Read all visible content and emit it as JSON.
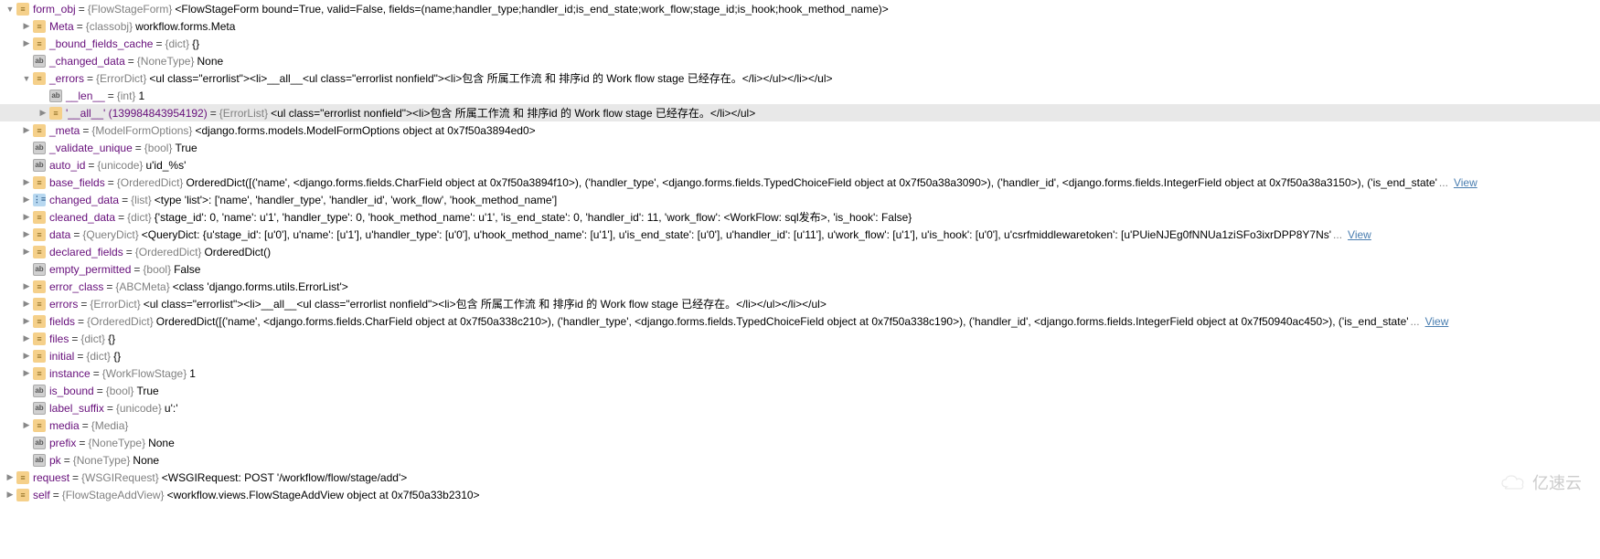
{
  "watermark": "亿速云",
  "icons": {
    "obj": "≡",
    "str": "ab",
    "list": "⋮≡"
  },
  "rows": [
    {
      "indent": 0,
      "arrow": "down",
      "icon": "obj",
      "name": "form_obj",
      "type": "{FlowStageForm}",
      "val": "<FlowStageForm bound=True, valid=False, fields=(name;handler_type;handler_id;is_end_state;work_flow;stage_id;is_hook;hook_method_name)>"
    },
    {
      "indent": 1,
      "arrow": "right",
      "icon": "obj",
      "name": "Meta",
      "type": "{classobj}",
      "val": "workflow.forms.Meta"
    },
    {
      "indent": 1,
      "arrow": "right",
      "icon": "obj",
      "name": "_bound_fields_cache",
      "type": "{dict}",
      "val": "{}"
    },
    {
      "indent": 1,
      "arrow": "blank",
      "icon": "str",
      "name": "_changed_data",
      "type": "{NoneType}",
      "val": "None"
    },
    {
      "indent": 1,
      "arrow": "down",
      "icon": "obj",
      "name": "_errors",
      "type": "{ErrorDict}",
      "val": "<ul class=\"errorlist\"><li>__all__<ul class=\"errorlist nonfield\"><li>包含 所属工作流 和 排序id 的 Work flow stage 已经存在。</li></ul></li></ul>"
    },
    {
      "indent": 2,
      "arrow": "blank",
      "icon": "str",
      "name": "__len__",
      "type": "{int}",
      "val": "1"
    },
    {
      "indent": 2,
      "arrow": "right",
      "icon": "obj",
      "name": "'__all__' (139984843954192)",
      "type": "{ErrorList}",
      "val": "<ul class=\"errorlist nonfield\"><li>包含 所属工作流 和 排序id 的 Work flow stage 已经存在。</li></ul>",
      "highlighted": true
    },
    {
      "indent": 1,
      "arrow": "right",
      "icon": "obj",
      "name": "_meta",
      "type": "{ModelFormOptions}",
      "val": "<django.forms.models.ModelFormOptions object at 0x7f50a3894ed0>"
    },
    {
      "indent": 1,
      "arrow": "blank",
      "icon": "str",
      "name": "_validate_unique",
      "type": "{bool}",
      "val": "True"
    },
    {
      "indent": 1,
      "arrow": "blank",
      "icon": "str",
      "name": "auto_id",
      "type": "{unicode}",
      "val": "u'id_%s'"
    },
    {
      "indent": 1,
      "arrow": "right",
      "icon": "obj",
      "name": "base_fields",
      "type": "{OrderedDict}",
      "val": "OrderedDict([('name', <django.forms.fields.CharField object at 0x7f50a3894f10>), ('handler_type', <django.forms.fields.TypedChoiceField object at 0x7f50a38a3090>), ('handler_id', <django.forms.fields.IntegerField object at 0x7f50a38a3150>), ('is_end_state'",
      "view": true
    },
    {
      "indent": 1,
      "arrow": "right",
      "icon": "list",
      "name": "changed_data",
      "type": "{list}",
      "val": "<type 'list'>: ['name', 'handler_type', 'handler_id', 'work_flow', 'hook_method_name']"
    },
    {
      "indent": 1,
      "arrow": "right",
      "icon": "obj",
      "name": "cleaned_data",
      "type": "{dict}",
      "val": "{'stage_id': 0, 'name': u'1', 'handler_type': 0, 'hook_method_name': u'1', 'is_end_state': 0, 'handler_id': 11, 'work_flow': <WorkFlow: sql发布>, 'is_hook': False}"
    },
    {
      "indent": 1,
      "arrow": "right",
      "icon": "obj",
      "name": "data",
      "type": "{QueryDict}",
      "val": "<QueryDict: {u'stage_id': [u'0'], u'name': [u'1'], u'handler_type': [u'0'], u'hook_method_name': [u'1'], u'is_end_state': [u'0'], u'handler_id': [u'11'], u'work_flow': [u'1'], u'is_hook': [u'0'], u'csrfmiddlewaretoken': [u'PUieNJEg0fNNUa1ziSFo3ixrDPP8Y7Ns'",
      "view": true
    },
    {
      "indent": 1,
      "arrow": "right",
      "icon": "obj",
      "name": "declared_fields",
      "type": "{OrderedDict}",
      "val": "OrderedDict()"
    },
    {
      "indent": 1,
      "arrow": "blank",
      "icon": "str",
      "name": "empty_permitted",
      "type": "{bool}",
      "val": "False"
    },
    {
      "indent": 1,
      "arrow": "right",
      "icon": "obj",
      "name": "error_class",
      "type": "{ABCMeta}",
      "val": "<class 'django.forms.utils.ErrorList'>"
    },
    {
      "indent": 1,
      "arrow": "right",
      "icon": "obj",
      "name": "errors",
      "type": "{ErrorDict}",
      "val": "<ul class=\"errorlist\"><li>__all__<ul class=\"errorlist nonfield\"><li>包含 所属工作流 和 排序id 的 Work flow stage 已经存在。</li></ul></li></ul>"
    },
    {
      "indent": 1,
      "arrow": "right",
      "icon": "obj",
      "name": "fields",
      "type": "{OrderedDict}",
      "val": "OrderedDict([('name', <django.forms.fields.CharField object at 0x7f50a338c210>), ('handler_type', <django.forms.fields.TypedChoiceField object at 0x7f50a338c190>), ('handler_id', <django.forms.fields.IntegerField object at 0x7f50940ac450>), ('is_end_state'",
      "view": true
    },
    {
      "indent": 1,
      "arrow": "right",
      "icon": "obj",
      "name": "files",
      "type": "{dict}",
      "val": "{}"
    },
    {
      "indent": 1,
      "arrow": "right",
      "icon": "obj",
      "name": "initial",
      "type": "{dict}",
      "val": "{}"
    },
    {
      "indent": 1,
      "arrow": "right",
      "icon": "obj",
      "name": "instance",
      "type": "{WorkFlowStage}",
      "val": "1"
    },
    {
      "indent": 1,
      "arrow": "blank",
      "icon": "str",
      "name": "is_bound",
      "type": "{bool}",
      "val": "True"
    },
    {
      "indent": 1,
      "arrow": "blank",
      "icon": "str",
      "name": "label_suffix",
      "type": "{unicode}",
      "val": "u':'"
    },
    {
      "indent": 1,
      "arrow": "right",
      "icon": "obj",
      "name": "media",
      "type": "{Media}",
      "val": ""
    },
    {
      "indent": 1,
      "arrow": "blank",
      "icon": "str",
      "name": "prefix",
      "type": "{NoneType}",
      "val": "None"
    },
    {
      "indent": 0,
      "arrow": "blank",
      "icon": "str",
      "name": "pk",
      "type": "{NoneType}",
      "val": "None",
      "extraIndent": true
    },
    {
      "indent": 0,
      "arrow": "right",
      "icon": "obj",
      "name": "request",
      "type": "{WSGIRequest}",
      "val": "<WSGIRequest: POST '/workflow/flow/stage/add'>"
    },
    {
      "indent": 0,
      "arrow": "right",
      "icon": "obj",
      "name": "self",
      "type": "{FlowStageAddView}",
      "val": "<workflow.views.FlowStageAddView object at 0x7f50a33b2310>"
    }
  ],
  "viewLabel": "View"
}
